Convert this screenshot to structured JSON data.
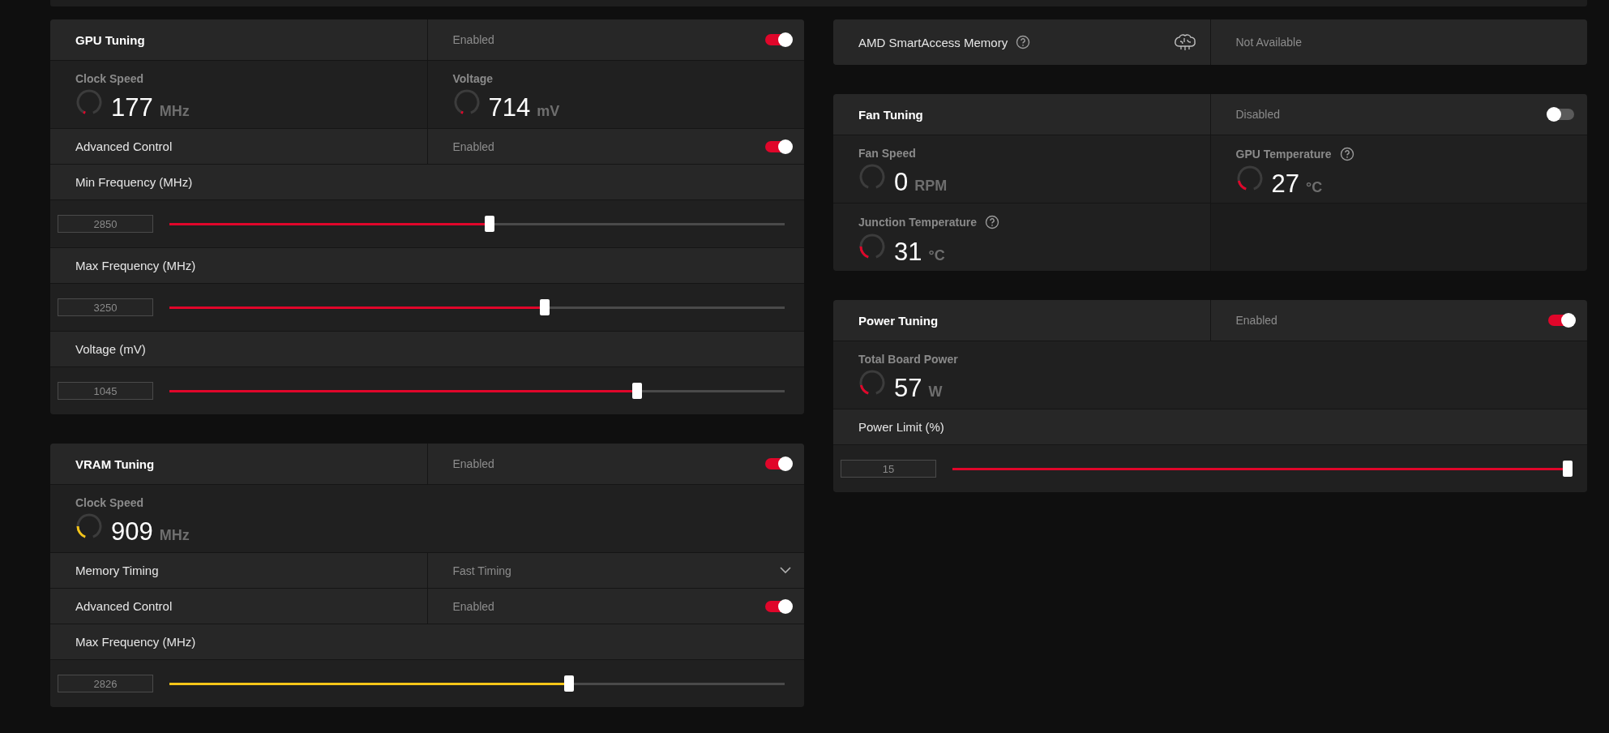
{
  "left_column": [
    {
      "rows": [
        {
          "kind": "header",
          "title": "GPU Tuning",
          "status": "Enabled",
          "on": true
        },
        {
          "kind": "metrics",
          "items": [
            {
              "label": "Clock Speed",
              "value": "177",
              "unit": "MHz",
              "color": "#e0062a"
            },
            {
              "label": "Voltage",
              "value": "714",
              "unit": "mV",
              "color": "#e0062a"
            }
          ]
        },
        {
          "kind": "toggle_setting",
          "label": "Advanced Control",
          "value": "Enabled",
          "on": true
        },
        {
          "kind": "label",
          "label": "Min Frequency (MHz)"
        },
        {
          "kind": "slider",
          "value": "2850",
          "level": 0.52,
          "color": "#e0062a"
        },
        {
          "kind": "label",
          "label": "Max Frequency (MHz)"
        },
        {
          "kind": "slider",
          "value": "3250",
          "level": 0.61,
          "color": "#e0062a"
        },
        {
          "kind": "label",
          "label": "Voltage (mV)"
        },
        {
          "kind": "slider",
          "value": "1045",
          "level": 0.76,
          "color": "#e0062a"
        }
      ]
    },
    {
      "rows": [
        {
          "kind": "header",
          "title": "VRAM Tuning",
          "status": "Enabled",
          "on": true
        },
        {
          "kind": "metrics",
          "items": [
            {
              "label": "Clock Speed",
              "value": "909",
              "unit": "MHz",
              "level": 0.22,
              "color": "#f5c518"
            }
          ]
        },
        {
          "kind": "dropdown_setting",
          "label": "Memory Timing",
          "value": "Fast Timing"
        },
        {
          "kind": "toggle_setting",
          "label": "Advanced Control",
          "value": "Enabled",
          "on": true
        },
        {
          "kind": "label",
          "label": "Max Frequency (MHz)"
        },
        {
          "kind": "slider",
          "value": "2826",
          "level": 0.65,
          "color": "#f5c518"
        }
      ]
    }
  ],
  "right_column": [
    {
      "rows": [
        {
          "kind": "feature",
          "label": "AMD SmartAccess Memory",
          "help": true,
          "value": "Not Available"
        }
      ]
    },
    {
      "rows": [
        {
          "kind": "header",
          "title": "Fan Tuning",
          "status": "Disabled",
          "on": false
        },
        {
          "kind": "metrics",
          "items": [
            {
              "label": "Fan Speed",
              "value": "0",
              "unit": "RPM"
            },
            {
              "label": "GPU Temperature",
              "help": true,
              "value": "27",
              "unit": "°C",
              "level": 0.18,
              "color": "#e0062a"
            }
          ]
        },
        {
          "kind": "metrics",
          "items": [
            {
              "label": "Junction Temperature",
              "help": true,
              "value": "31",
              "unit": "°C",
              "level": 0.22,
              "color": "#e0062a"
            }
          ],
          "empty_cell": true
        }
      ]
    },
    {
      "rows": [
        {
          "kind": "header",
          "title": "Power Tuning",
          "status": "Enabled",
          "on": true
        },
        {
          "kind": "metrics",
          "items": [
            {
              "label": "Total Board Power",
              "value": "57",
              "unit": "W",
              "level": 0.18,
              "color": "#e0062a"
            }
          ]
        },
        {
          "kind": "label",
          "label": "Power Limit (%)"
        },
        {
          "kind": "slider",
          "value": "15",
          "level": 1,
          "color": "#e0062a"
        }
      ]
    }
  ]
}
